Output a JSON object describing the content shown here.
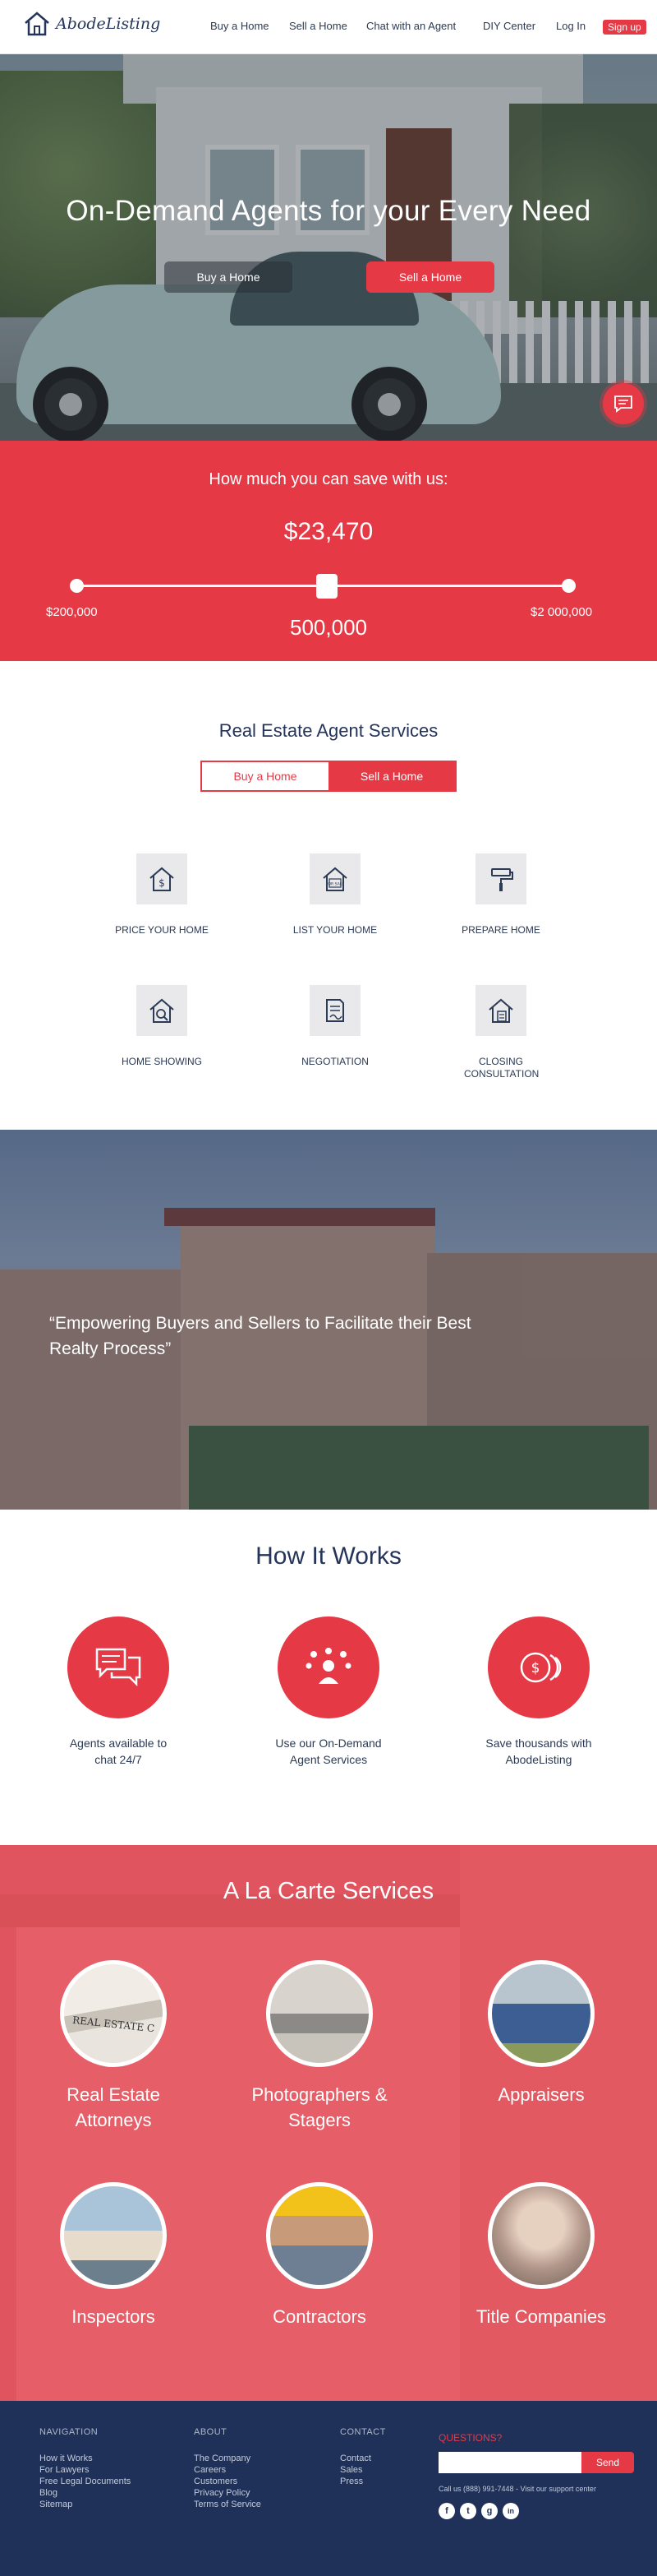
{
  "header": {
    "logo_text": "AbodeListing",
    "nav": [
      "Buy a Home",
      "Sell a Home",
      "Chat with an Agent",
      "DIY Center",
      "Log In"
    ],
    "signup": "Sign up"
  },
  "hero": {
    "title": "On-Demand Agents for your Every Need",
    "buy_button": "Buy a Home",
    "sell_button": "Sell a Home"
  },
  "savings": {
    "question": "How much you can save with us:",
    "amount": "$23,470",
    "min_label": "$200,000",
    "max_label": "$2 000,000",
    "value_label": "500,000",
    "slider_fraction": 0.17
  },
  "services": {
    "title": "Real Estate Agent Services",
    "toggle": [
      "Buy a Home",
      "Sell a Home"
    ],
    "items": [
      {
        "label": "PRICE YOUR HOME"
      },
      {
        "label": "LIST YOUR HOME",
        "icon_text": "FOR SALE"
      },
      {
        "label": "PREPARE HOME"
      },
      {
        "label": "HOME SHOWING"
      },
      {
        "label": "NEGOTIATION"
      },
      {
        "label": "CLOSING CONSULTATION"
      }
    ]
  },
  "quote": {
    "text": "“Empowering Buyers and Sellers to Facilitate their Best Realty Process”"
  },
  "how_it_works": {
    "title": "How It Works",
    "items": [
      {
        "text": "Agents available to chat 24/7"
      },
      {
        "text": "Use our On-Demand Agent Services"
      },
      {
        "text": "Save thousands with AbodeListing"
      }
    ]
  },
  "alacarte": {
    "title": "A La Carte Services",
    "items": [
      {
        "label": "Real Estate Attorneys",
        "photo_text": "REAL ESTATE C"
      },
      {
        "label": "Photographers & Stagers"
      },
      {
        "label": "Appraisers"
      },
      {
        "label": "Inspectors"
      },
      {
        "label": "Contractors"
      },
      {
        "label": "Title Companies"
      }
    ]
  },
  "footer": {
    "navigation": {
      "heading": "NAVIGATION",
      "links": [
        "How it Works",
        "For Lawyers",
        "Free Legal Documents",
        "Blog",
        "Sitemap"
      ]
    },
    "about": {
      "heading": "ABOUT",
      "links": [
        "The Company",
        "Careers",
        "Customers",
        "Privacy Policy",
        "Terms of Service"
      ]
    },
    "contact": {
      "heading": "CONTACT",
      "links": [
        "Contact",
        "Sales",
        "Press"
      ]
    },
    "questions": "QUESTIONS?",
    "send": "Send",
    "call_text": "Call us (888) 991-7448 - Visit our support center",
    "social": [
      "f",
      "t",
      "g",
      "in"
    ]
  },
  "colors": {
    "accent": "#e63946",
    "navy": "#1f3158",
    "text": "#2b3a55"
  }
}
